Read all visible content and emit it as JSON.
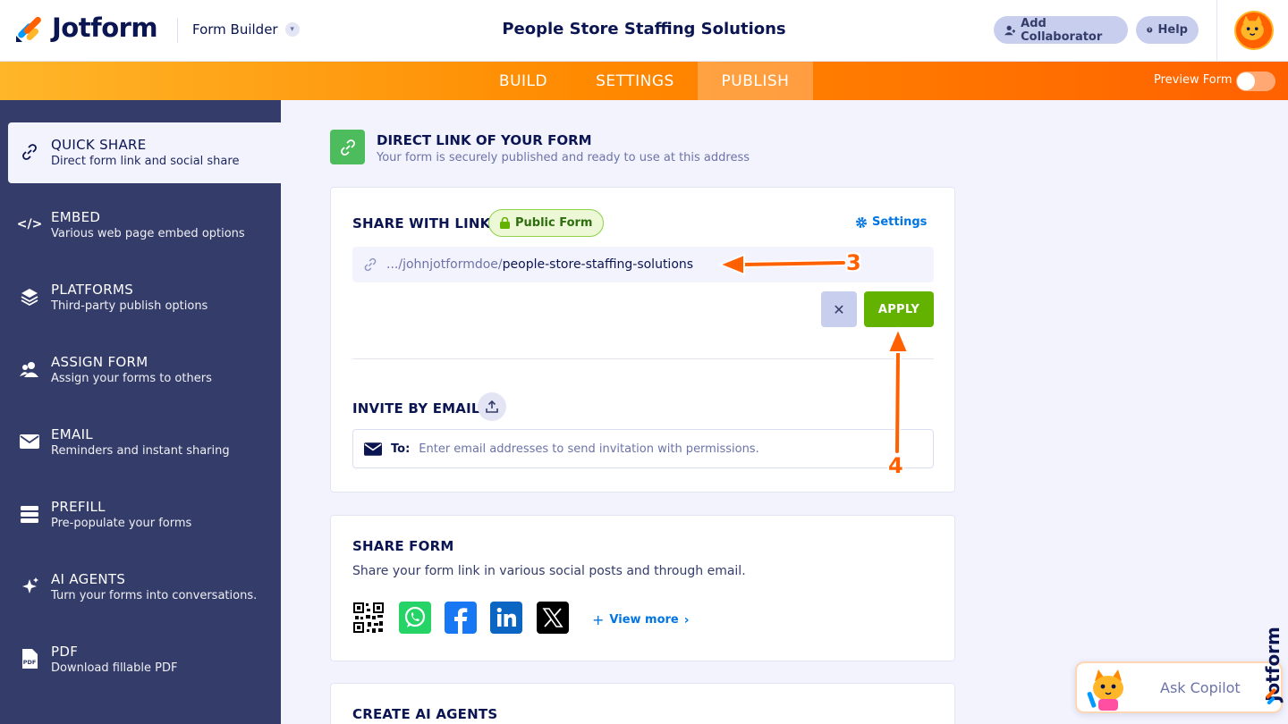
{
  "brand": {
    "name": "Jotform",
    "accent": "#ff6100"
  },
  "header": {
    "builder_label": "Form Builder",
    "form_title": "People Store Staffing Solutions",
    "add_collaborator": "Add Collaborator",
    "help": "Help"
  },
  "nav": {
    "tabs": [
      {
        "label": "BUILD"
      },
      {
        "label": "SETTINGS"
      },
      {
        "label": "PUBLISH"
      }
    ],
    "active_tab": "PUBLISH",
    "preview_label": "Preview Form",
    "preview_enabled": false
  },
  "sidebar": {
    "items": [
      {
        "title": "QUICK SHARE",
        "subtitle": "Direct form link and social share",
        "icon": "link-icon"
      },
      {
        "title": "EMBED",
        "subtitle": "Various web page embed options",
        "icon": "code-icon"
      },
      {
        "title": "PLATFORMS",
        "subtitle": "Third-party publish options",
        "icon": "layers-icon"
      },
      {
        "title": "ASSIGN FORM",
        "subtitle": "Assign your forms to others",
        "icon": "users-icon"
      },
      {
        "title": "EMAIL",
        "subtitle": "Reminders and instant sharing",
        "icon": "envelope-icon"
      },
      {
        "title": "PREFILL",
        "subtitle": "Pre-populate your forms",
        "icon": "prefill-icon"
      },
      {
        "title": "AI AGENTS",
        "subtitle": "Turn your forms into conversations.",
        "icon": "sparkle-icon"
      },
      {
        "title": "PDF",
        "subtitle": "Download fillable PDF",
        "icon": "pdf-icon"
      }
    ],
    "active_index": 0
  },
  "direct_link": {
    "title": "DIRECT LINK OF YOUR FORM",
    "subtitle": "Your form is securely published and ready to use at this address"
  },
  "share_link": {
    "title": "SHARE WITH LINK",
    "badge": "Public Form",
    "settings_label": "Settings",
    "url_prefix": ".../johnjotformdoe/",
    "url_slug": "people-store-staffing-solutions",
    "cancel_symbol": "✕",
    "apply_label": "APPLY"
  },
  "invite": {
    "title": "INVITE BY EMAIL",
    "to_label": "To:",
    "placeholder": "Enter email addresses to send invitation with permissions."
  },
  "share_form": {
    "title": "SHARE FORM",
    "subtitle": "Share your form link in various social posts and through email.",
    "socials": [
      "qr-code-icon",
      "whatsapp-icon",
      "facebook-icon",
      "linkedin-icon",
      "x-icon"
    ],
    "view_more": "View more"
  },
  "ai_agents_card": {
    "title": "CREATE AI AGENTS"
  },
  "copilot": {
    "label": "Ask Copilot"
  },
  "annotations": {
    "step3": "3",
    "step4": "4",
    "color": "#ff6100"
  }
}
